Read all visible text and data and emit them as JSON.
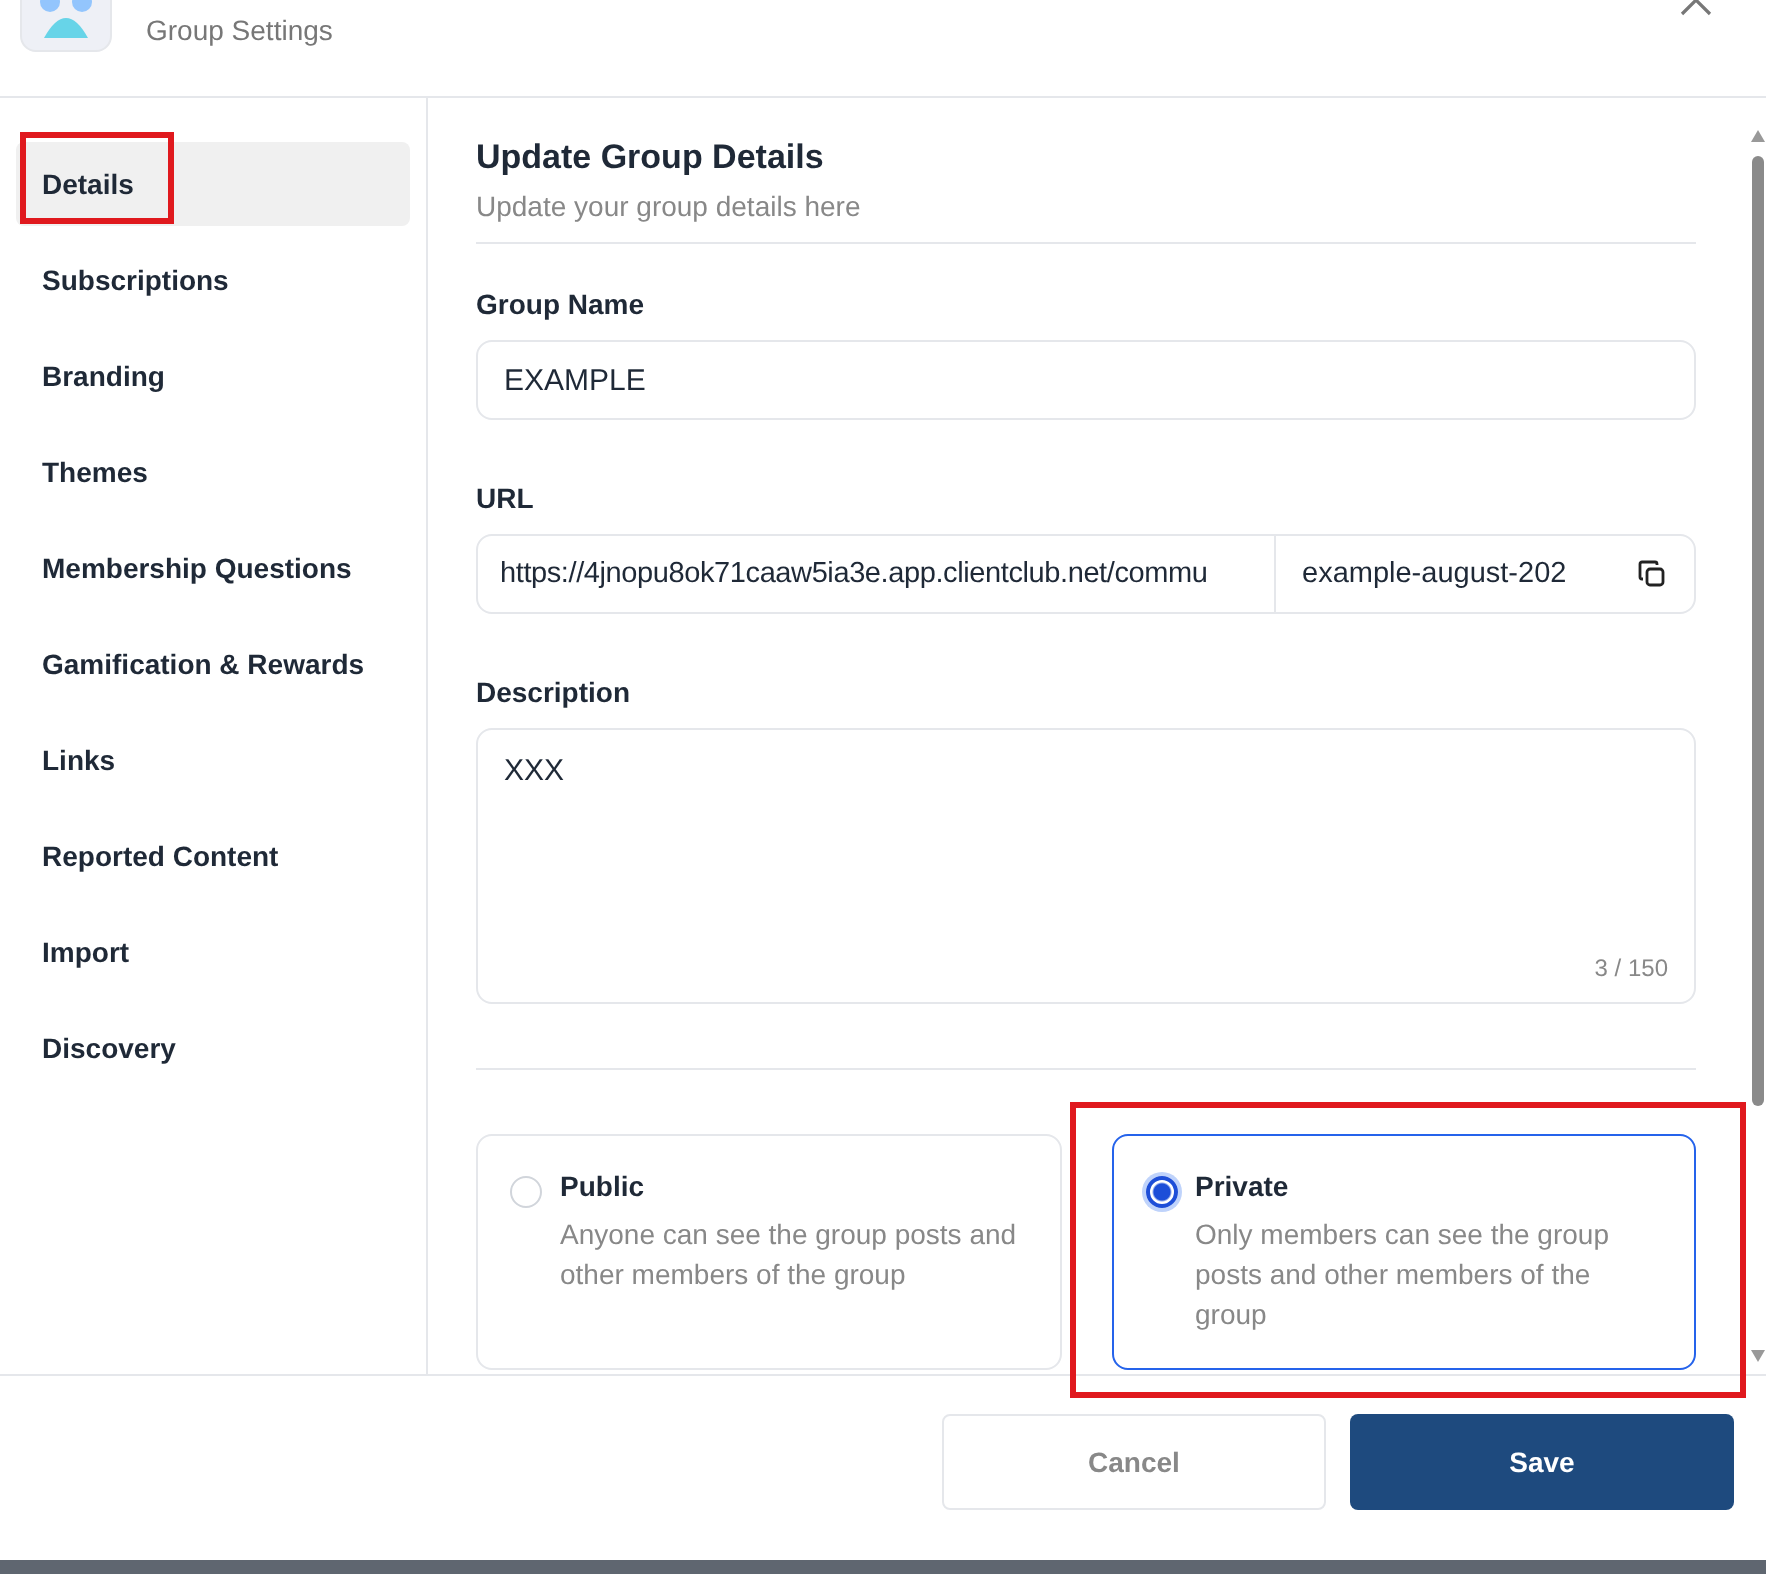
{
  "header": {
    "subtitle": "Group Settings"
  },
  "nav": [
    {
      "label": "Details",
      "selected": true,
      "highlighted": true
    },
    {
      "label": "Subscriptions",
      "selected": false,
      "highlighted": false
    },
    {
      "label": "Branding",
      "selected": false,
      "highlighted": false
    },
    {
      "label": "Themes",
      "selected": false,
      "highlighted": false
    },
    {
      "label": "Membership Questions",
      "selected": false,
      "highlighted": false
    },
    {
      "label": "Gamification & Rewards",
      "selected": false,
      "highlighted": false
    },
    {
      "label": "Links",
      "selected": false,
      "highlighted": false
    },
    {
      "label": "Reported Content",
      "selected": false,
      "highlighted": false
    },
    {
      "label": "Import",
      "selected": false,
      "highlighted": false
    },
    {
      "label": "Discovery",
      "selected": false,
      "highlighted": false
    }
  ],
  "section": {
    "title": "Update Group Details",
    "subtitle": "Update your group details here"
  },
  "group_name": {
    "label": "Group Name",
    "value": "EXAMPLE"
  },
  "url": {
    "label": "URL",
    "base": "https://4jnopu8ok71caaw5ia3e.app.clientclub.net/commu",
    "slug": "example-august-202"
  },
  "description": {
    "label": "Description",
    "value": "XXX",
    "counter": "3 / 150"
  },
  "privacy": [
    {
      "label": "Public",
      "description": "Anyone can see the group posts and other members of the group",
      "selected": false,
      "highlighted": false
    },
    {
      "label": "Private",
      "description": "Only members can see the group posts and other members of the group",
      "selected": true,
      "highlighted": true
    }
  ],
  "buttons": {
    "cancel": "Cancel",
    "save": "Save"
  }
}
